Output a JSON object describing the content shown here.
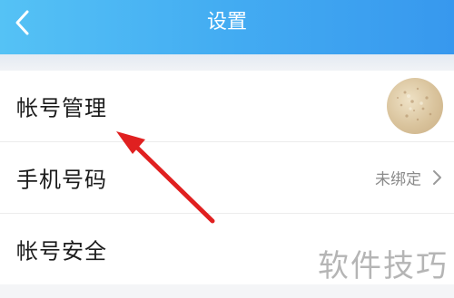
{
  "header": {
    "title": "设置",
    "back_icon": "chevron-left-icon",
    "background_colors": [
      "#55c2f5",
      "#3798ee"
    ]
  },
  "settings": {
    "items": [
      {
        "label": "帐号管理",
        "trailing": "avatar"
      },
      {
        "label": "手机号码",
        "value": "未绑定",
        "trailing_icon": "chevron-right-icon"
      },
      {
        "label": "帐号安全"
      }
    ]
  },
  "annotation": {
    "arrow_color": "#e02020",
    "points_to": "帐号管理"
  },
  "watermark": {
    "text": "软件技巧"
  }
}
